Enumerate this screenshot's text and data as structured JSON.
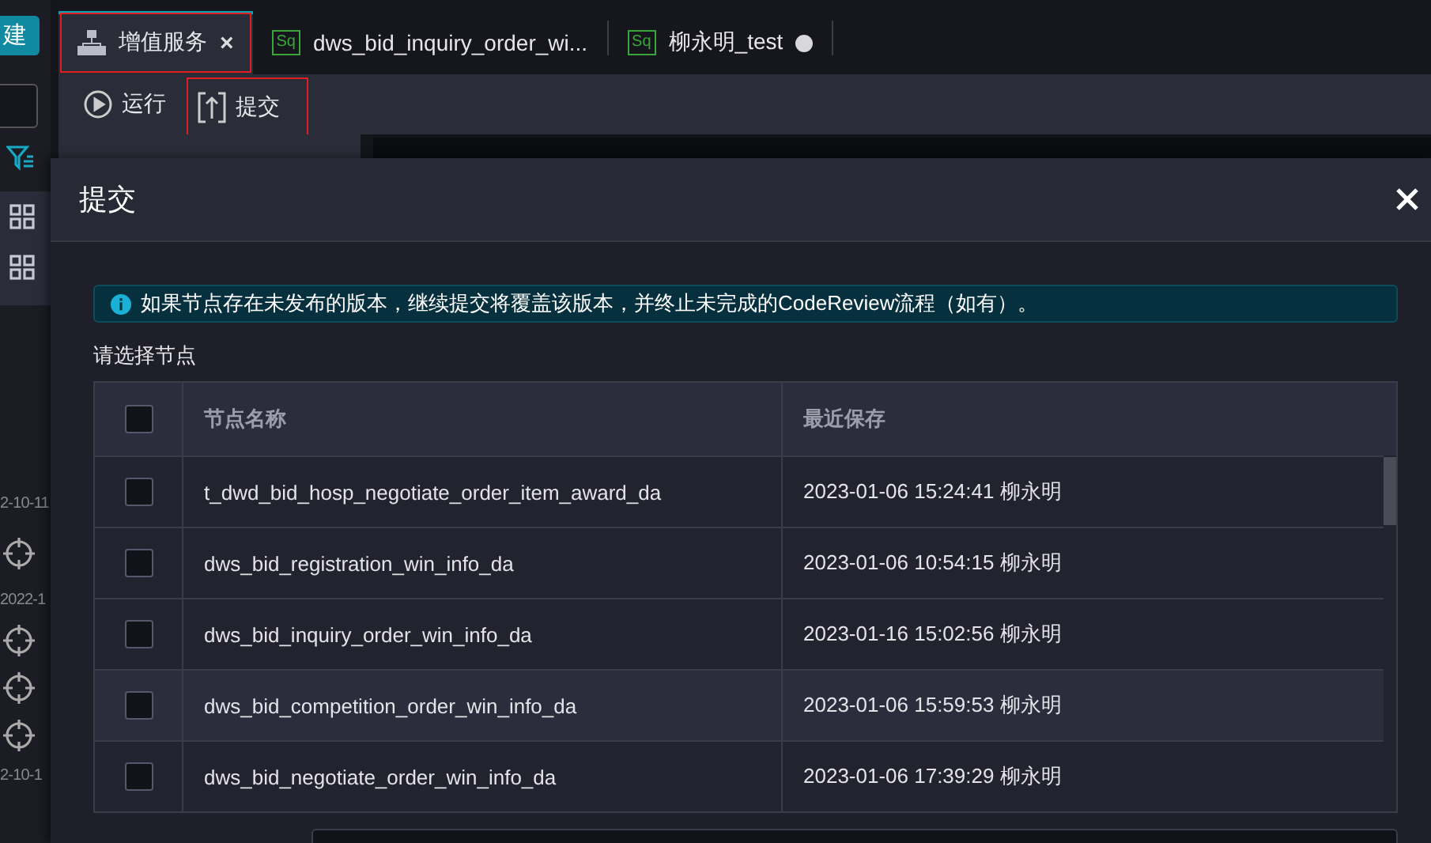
{
  "sidebar": {
    "new_button": "建",
    "dates": [
      "2-10-11",
      "2022-1",
      "2-10-1"
    ]
  },
  "tabs": [
    {
      "kind": "workflow",
      "label": "增值服务",
      "selected": true,
      "close": "×",
      "modified": false,
      "highlighted": true
    },
    {
      "kind": "sql",
      "badge": "Sq",
      "label": "dws_bid_inquiry_order_wi...",
      "selected": false,
      "modified": false,
      "highlighted": false
    },
    {
      "kind": "sql",
      "badge": "Sq",
      "label": "柳永明_test",
      "selected": false,
      "modified": true,
      "highlighted": false
    }
  ],
  "toolbar": [
    {
      "kind": "run",
      "label": "运行",
      "highlighted": false
    },
    {
      "kind": "submit",
      "label": "提交",
      "highlighted": true
    }
  ],
  "modal": {
    "title": "提交",
    "notice": "如果节点存在未发布的版本，继续提交将覆盖该版本，并终止未完成的CodeReview流程（如有）。",
    "section_label": "请选择节点",
    "table": {
      "select_all_checked": false,
      "columns": [
        "节点名称",
        "最近保存"
      ],
      "rows": [
        {
          "name": "t_dwd_bid_hosp_negotiate_order_item_award_da",
          "saved": "2023-01-06 15:24:41 柳永明",
          "checked": false,
          "hovered": false
        },
        {
          "name": "dws_bid_registration_win_info_da",
          "saved": "2023-01-06 10:54:15 柳永明",
          "checked": false,
          "hovered": false
        },
        {
          "name": "dws_bid_inquiry_order_win_info_da",
          "saved": "2023-01-16 15:02:56 柳永明",
          "checked": false,
          "hovered": false
        },
        {
          "name": "dws_bid_competition_order_win_info_da",
          "saved": "2023-01-06 15:59:53 柳永明",
          "checked": false,
          "hovered": true
        },
        {
          "name": "dws_bid_negotiate_order_win_info_da",
          "saved": "2023-01-06 17:39:29 柳永明",
          "checked": false,
          "hovered": false
        }
      ]
    }
  }
}
